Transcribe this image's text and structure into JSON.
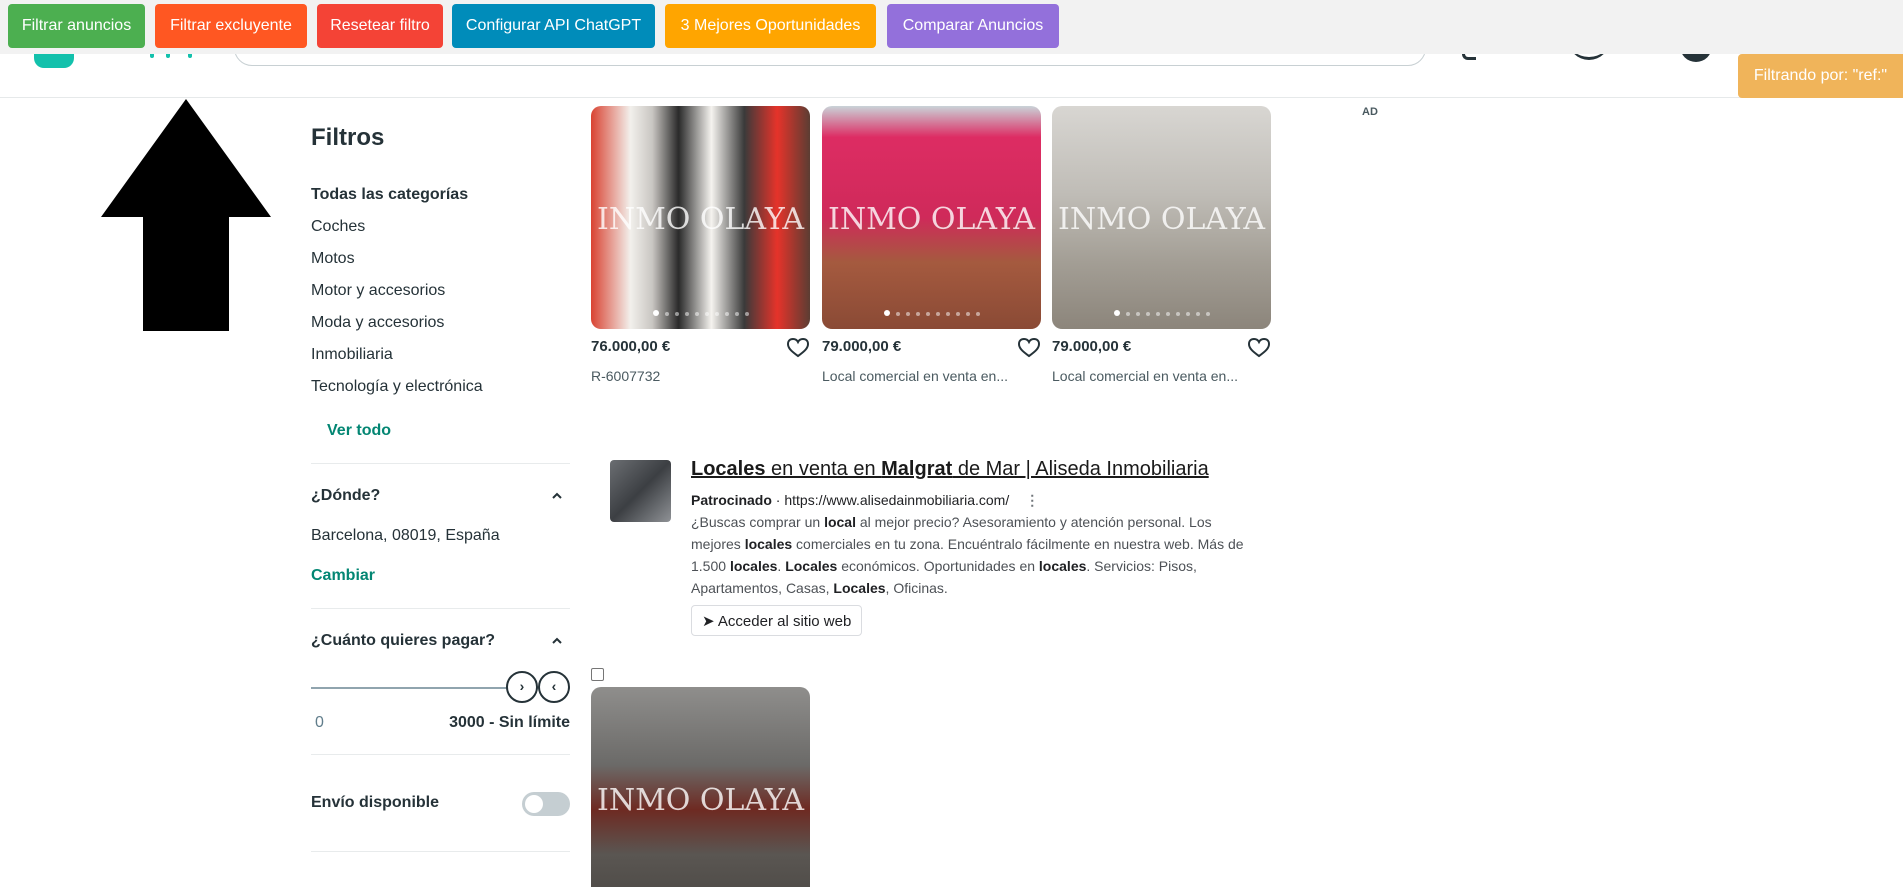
{
  "toolbar": {
    "buttons": [
      {
        "label": "Filtrar anuncios",
        "color": "#4caf50"
      },
      {
        "label": "Filtrar excluyente",
        "color": "#ff5722"
      },
      {
        "label": "Resetear filtro",
        "color": "#f44336"
      },
      {
        "label": "Configurar API ChatGPT",
        "color": "#008cba"
      },
      {
        "label": "3 Mejores Oportunidades",
        "color": "#ffa500"
      },
      {
        "label": "Comparar Anuncios",
        "color": "#9370db"
      }
    ],
    "filter_status": "Filtrando por: \"ref:\""
  },
  "sidebar": {
    "title": "Filtros",
    "categories": [
      "Todas las categorías",
      "Coches",
      "Motos",
      "Motor y accesorios",
      "Moda y accesorios",
      "Inmobiliaria",
      "Tecnología y electrónica"
    ],
    "see_all": "Ver todo",
    "location": {
      "heading": "¿Dónde?",
      "value": "Barcelona, 08019, España",
      "change": "Cambiar"
    },
    "price": {
      "heading": "¿Cuánto quieres pagar?",
      "min": "0",
      "max": "3000 - Sin límite"
    },
    "shipping": {
      "label": "Envío disponible",
      "enabled": false
    }
  },
  "listings": [
    {
      "price": "76.000,00 €",
      "subtitle": "R-6007732",
      "watermark": "INMO OLAYA"
    },
    {
      "price": "79.000,00 €",
      "subtitle": "Local comercial en venta en...",
      "watermark": "INMO OLAYA"
    },
    {
      "price": "79.000,00 €",
      "subtitle": "Local comercial en venta en...",
      "watermark": "INMO OLAYA"
    },
    {
      "watermark": "INMO OLAYA"
    }
  ],
  "ad_label": "AD",
  "sponsored_ad": {
    "title_parts": [
      "Locales",
      " en venta en ",
      "Malgrat",
      " de Mar | Aliseda Inmobiliaria"
    ],
    "sponsor_label": "Patrocinado",
    "url": "https://www.alisedainmobiliaria.com/",
    "description_parts": [
      "¿Buscas comprar un ",
      "local",
      " al mejor precio? Asesoramiento y atención personal. Los mejores ",
      "locales",
      " comerciales en tu zona. Encuéntralo fácilmente en nuestra web. Más de 1.500 ",
      "locales",
      ". ",
      "Locales",
      " económicos. Oportunidades en ",
      "locales",
      ". Servicios: Pisos, Apartamentos, Casas, ",
      "Locales",
      ", Oficinas."
    ],
    "cta": "➤ Acceder al sitio web"
  }
}
